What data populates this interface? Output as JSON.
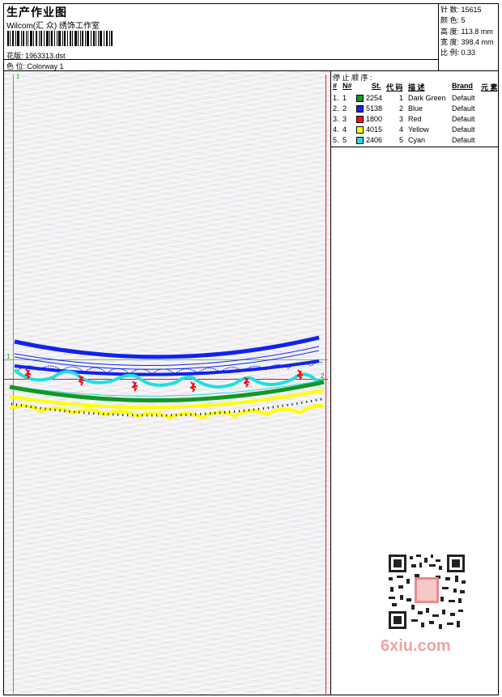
{
  "header": {
    "title": "生产作业图",
    "studio": "Wilcom(汇 众) 绣饰工作室",
    "design_label": "花版: 1963313.dst",
    "colorway_label": "色 位:  Colorway 1"
  },
  "stats": {
    "stitches": "针 数:  15615",
    "colors": "颜 色:  5",
    "height": "高 度:  113.8 mm",
    "width": "宽 度:  398.4 mm",
    "scale": "比 例:  0.33"
  },
  "stop_sequence": {
    "title": "停 止 顺 序 :",
    "headers": [
      "#",
      "N#",
      "St.",
      "代 码",
      "描 述",
      "Brand",
      "元 素"
    ],
    "rows": [
      {
        "idx": "1.",
        "n": "1",
        "color": "#119922",
        "stitches": "2254",
        "code": "1",
        "desc": "Dark Green",
        "brand": "Default"
      },
      {
        "idx": "2.",
        "n": "2",
        "color": "#1122ee",
        "stitches": "5138",
        "code": "2",
        "desc": "Blue",
        "brand": "Default"
      },
      {
        "idx": "3.",
        "n": "3",
        "color": "#ee1111",
        "stitches": "1800",
        "code": "3",
        "desc": "Red",
        "brand": "Default"
      },
      {
        "idx": "4.",
        "n": "4",
        "color": "#ffff00",
        "stitches": "4015",
        "code": "4",
        "desc": "Yellow",
        "brand": "Default"
      },
      {
        "idx": "5.",
        "n": "5",
        "color": "#22dddd",
        "stitches": "2406",
        "code": "5",
        "desc": "Cyan",
        "brand": "Default"
      }
    ]
  },
  "canvas": {
    "marker_top": "1",
    "marker_left": "1",
    "marker_right": "2"
  },
  "watermark": {
    "site": "6xiu.com"
  }
}
